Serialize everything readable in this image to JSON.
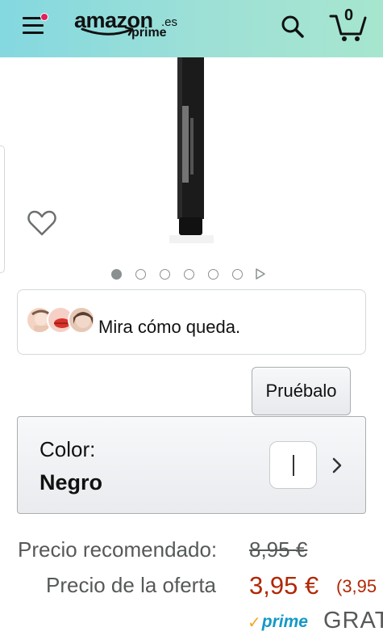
{
  "header": {
    "logo_word": "amazon",
    "logo_tld": ".es",
    "logo_sub": "prime",
    "cart_count": "0",
    "icons": {
      "menu": "menu-icon",
      "search": "search-icon",
      "cart": "cart-icon"
    }
  },
  "product": {
    "image_icon": "product-image",
    "wishlist_icon": "heart-icon",
    "carousel": {
      "count": 6,
      "active_index": 0,
      "has_video": true
    }
  },
  "tryon": {
    "text": "Mira cómo queda."
  },
  "pruebalo_label": "Pruébalo",
  "color": {
    "label": "Color:",
    "value": "Negro"
  },
  "prices": {
    "recommended_label": "Precio recomendado:",
    "recommended_value": "8,95 €",
    "offer_label": "Precio de la oferta",
    "offer_value": "3,95 €",
    "unit_price": "(3,95",
    "prime_label": "prime",
    "shipping": "GRAT"
  },
  "colors": {
    "header_start": "#84d8e0",
    "header_end": "#a6e6cf",
    "price_red": "#b12704",
    "prime_blue": "#1399c6",
    "prime_check": "#f5a623",
    "notification": "#e0215b"
  }
}
